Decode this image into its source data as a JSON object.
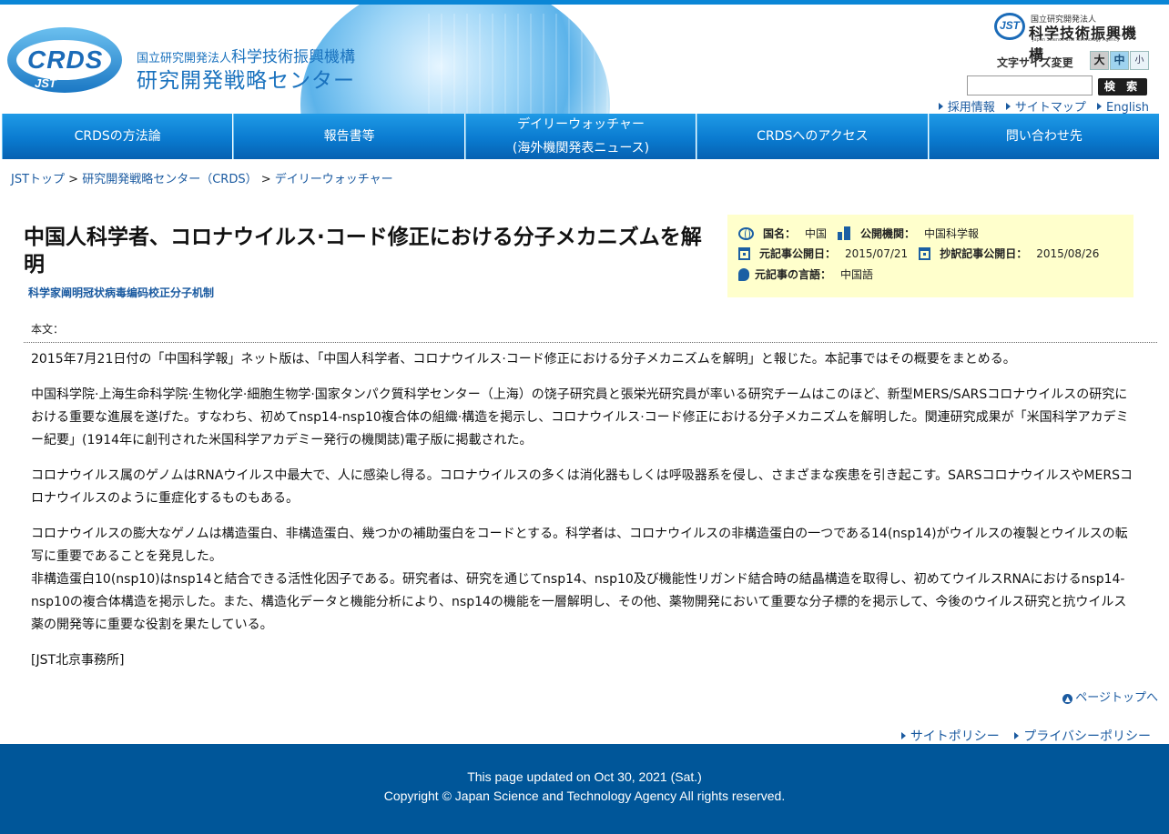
{
  "header": {
    "org_small": "国立研究開発法人",
    "org_name": "科学技術振興機構",
    "center_name": "研究開発戦略センター",
    "crds_logo_text": "CRDS",
    "crds_logo_sub": "JST",
    "jst_logo": {
      "mark": "JST",
      "line1": "国立研究開発法人",
      "line2": "科学技術振興機構",
      "line3": "Japan Science and Technology Agency"
    },
    "font_size_label": "文字サイズ変更",
    "font_sizes": [
      "大",
      "中",
      "小"
    ],
    "search_placeholder": "",
    "search_button": "検 索",
    "links": [
      "採用情報",
      "サイトマップ",
      "English"
    ]
  },
  "nav": {
    "items": [
      {
        "label": "CRDSの方法論"
      },
      {
        "label": "報告書等"
      },
      {
        "label": "デイリーウォッチャー",
        "label2": "(海外機関発表ニュース)"
      },
      {
        "label": "CRDSへのアクセス"
      },
      {
        "label": "問い合わせ先"
      }
    ]
  },
  "breadcrumb": {
    "items": [
      "JSTトップ",
      "研究開発戦略センター（CRDS）",
      "デイリーウォッチャー"
    ],
    "separator": ">"
  },
  "article": {
    "title": "中国人科学者、コロナウイルス·コード修正における分子メカニズムを解明",
    "original_title": "科学家阐明冠状病毒编码校正分子机制",
    "meta": {
      "country_label": "国名：",
      "country": "中国",
      "publisher_label": "公開機関：",
      "publisher": "中国科学報",
      "orig_date_label": "元記事公開日：",
      "orig_date": "2015/07/21",
      "trans_date_label": "抄訳記事公開日：",
      "trans_date": "2015/08/26",
      "lang_label": "元記事の言語：",
      "lang": "中国語"
    },
    "body_label": "本文：",
    "paragraphs": [
      "2015年7月21日付の「中国科学報」ネット版は、「中国人科学者、コロナウイルス·コード修正における分子メカニズムを解明」と報じた。本記事ではその概要をまとめる。",
      "中国科学院·上海生命科学院·生物化学·細胞生物学·国家タンパク質科学センター（上海）の饶子研究員と張栄光研究員が率いる研究チームはこのほど、新型MERS/SARSコロナウイルスの研究における重要な進展を遂げた。すなわち、初めてnsp14-nsp10複合体の組織·構造を掲示し、コロナウイルス·コード修正における分子メカニズムを解明した。関連研究成果が「米国科学アカデミー紀要」(1914年に創刊された米国科学アカデミー発行の機関誌)電子版に掲載された。",
      "コロナウイルス属のゲノムはRNAウイルス中最大で、人に感染し得る。コロナウイルスの多くは消化器もしくは呼吸器系を侵し、さまざまな疾患を引き起こす。SARSコロナウイルスやMERSコロナウイルスのように重症化するものもある。",
      "コロナウイルスの膨大なゲノムは構造蛋白、非構造蛋白、幾つかの補助蛋白をコードとする。科学者は、コロナウイルスの非構造蛋白の一つである14(nsp14)がウイルスの複製とウイルスの転写に重要であることを発見した。",
      "非構造蛋白10(nsp10)はnsp14と結合できる活性化因子である。研究者は、研究を通じてnsp14、nsp10及び機能性リガンド結合時の結晶構造を取得し、初めてウイルスRNAにおけるnsp14-nsp10の複合体構造を掲示した。また、構造化データと機能分析により、nsp14の機能を一層解明し、その他、薬物開発において重要な分子標的を掲示して、今後のウイルス研究と抗ウイルス薬の開発等に重要な役割を果たしている。",
      "[JST北京事務所]"
    ]
  },
  "pagetop": "ページトップへ",
  "footer_links": [
    "サイトポリシー",
    "プライバシーポリシー"
  ],
  "footer": {
    "updated": "This page updated on Oct 30, 2021 (Sat.)",
    "copyright": "Copyright © Japan Science and Technology Agency All rights reserved."
  },
  "colors": {
    "accent": "#0a86d6",
    "nav_top": "#1f9ae6",
    "nav_bottom": "#0661b2",
    "link": "#1a5aa0",
    "meta_bg": "#ffffcc",
    "footer_bg": "#005699"
  }
}
